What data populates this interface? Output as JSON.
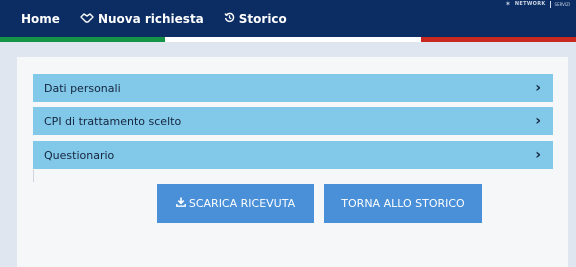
{
  "nav": {
    "home": "Home",
    "new_request": "Nuova richiesta",
    "history": "Storico"
  },
  "logo": {
    "brand": "NETWORK",
    "sub": "SERVIZI"
  },
  "accordion": [
    {
      "label": "Dati personali"
    },
    {
      "label": "CPI di trattamento scelto"
    },
    {
      "label": "Questionario"
    }
  ],
  "buttons": {
    "download": "SCARICA RICEVUTA",
    "back": "TORNA ALLO STORICO"
  },
  "colors": {
    "topbar": "#0b2d63",
    "accordion": "#82c8e9",
    "button": "#4a90d9",
    "flag_green": "#159447",
    "flag_red": "#c8281f"
  }
}
